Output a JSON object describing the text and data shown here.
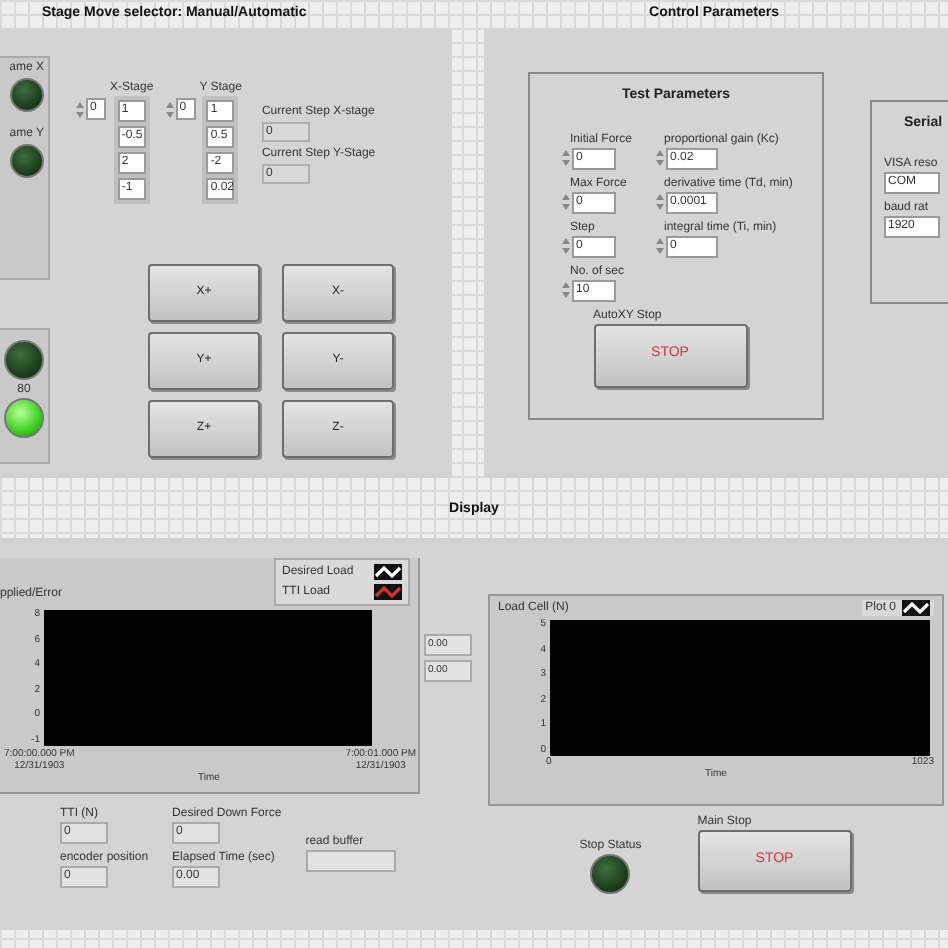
{
  "stage_panel": {
    "title": "Stage Move selector: Manual/Automatic",
    "upper_leds": [
      {
        "label": "ame X",
        "on": false
      },
      {
        "label": "ame Y",
        "on": false
      }
    ],
    "lower_leds": [
      {
        "on": false
      },
      {
        "label": "80",
        "on": true
      }
    ],
    "arrays": [
      {
        "label": "X-Stage",
        "index": "0",
        "values": [
          "1",
          "-0.5",
          "2",
          "-1"
        ]
      },
      {
        "label": "Y Stage",
        "index": "0",
        "values": [
          "1",
          "0.5",
          "-2",
          "0.02"
        ]
      }
    ],
    "current_steps": [
      {
        "label": "Current Step X-stage",
        "value": "0"
      },
      {
        "label": "Current Step Y-Stage",
        "value": "0"
      }
    ],
    "buttons": [
      "X+",
      "X-",
      "Y+",
      "Y-",
      "Z+",
      "Z-"
    ]
  },
  "control_panel": {
    "title": "Control Parameters",
    "test_parameters": {
      "title": "Test Parameters",
      "left_fields": [
        {
          "label": "Initial Force",
          "value": "0"
        },
        {
          "label": "Max Force",
          "value": "0"
        },
        {
          "label": "Step",
          "value": "0"
        },
        {
          "label": "No. of sec",
          "value": "10"
        }
      ],
      "right_fields": [
        {
          "label": "proportional gain (Kc)",
          "value": "0.02"
        },
        {
          "label": "derivative time (Td, min)",
          "value": "0.0001"
        },
        {
          "label": "integral time (Ti, min)",
          "value": "0"
        }
      ],
      "stop": {
        "label": "AutoXY Stop",
        "button": "STOP"
      }
    },
    "serial": {
      "title": "Serial",
      "fields": [
        {
          "label": "VISA reso",
          "value": "COM"
        },
        {
          "label": "baud rat",
          "value": "1920"
        }
      ]
    }
  },
  "display": {
    "title": "Display",
    "graph_left": {
      "title": "pplied/Error",
      "legend": [
        {
          "name": "Desired Load",
          "color": "#ffffff"
        },
        {
          "name": "TTI Load",
          "color": "#d03030"
        }
      ],
      "yticks": [
        "8",
        "6",
        "4",
        "2",
        "0",
        "-1"
      ],
      "xticks": [
        {
          "time": "7:00:00.000 PM",
          "date": "12/31/1903"
        },
        {
          "time": "7:00:01.000 PM",
          "date": "12/31/1903"
        }
      ],
      "xlabel": "Time"
    },
    "side_values": [
      "0.00",
      "0.00"
    ],
    "graph_right": {
      "title": "Load Cell (N)",
      "legend": [
        {
          "name": "Plot 0",
          "color": "#ffffff"
        }
      ],
      "yticks": [
        "5",
        "4",
        "3",
        "2",
        "1",
        "0"
      ],
      "xticks": [
        "0",
        "1023"
      ],
      "xlabel": "Time"
    },
    "indicators": [
      {
        "label": "TTI (N)",
        "value": "0"
      },
      {
        "label": "encoder position",
        "value": "0"
      },
      {
        "label": "Desired Down Force",
        "value": "0"
      },
      {
        "label": "Elapsed Time (sec)",
        "value": "0.00"
      },
      {
        "label": "read buffer"
      }
    ],
    "stop_status": {
      "label": "Stop Status",
      "on": false
    },
    "main_stop": {
      "label": "Main Stop",
      "button": "STOP"
    }
  }
}
